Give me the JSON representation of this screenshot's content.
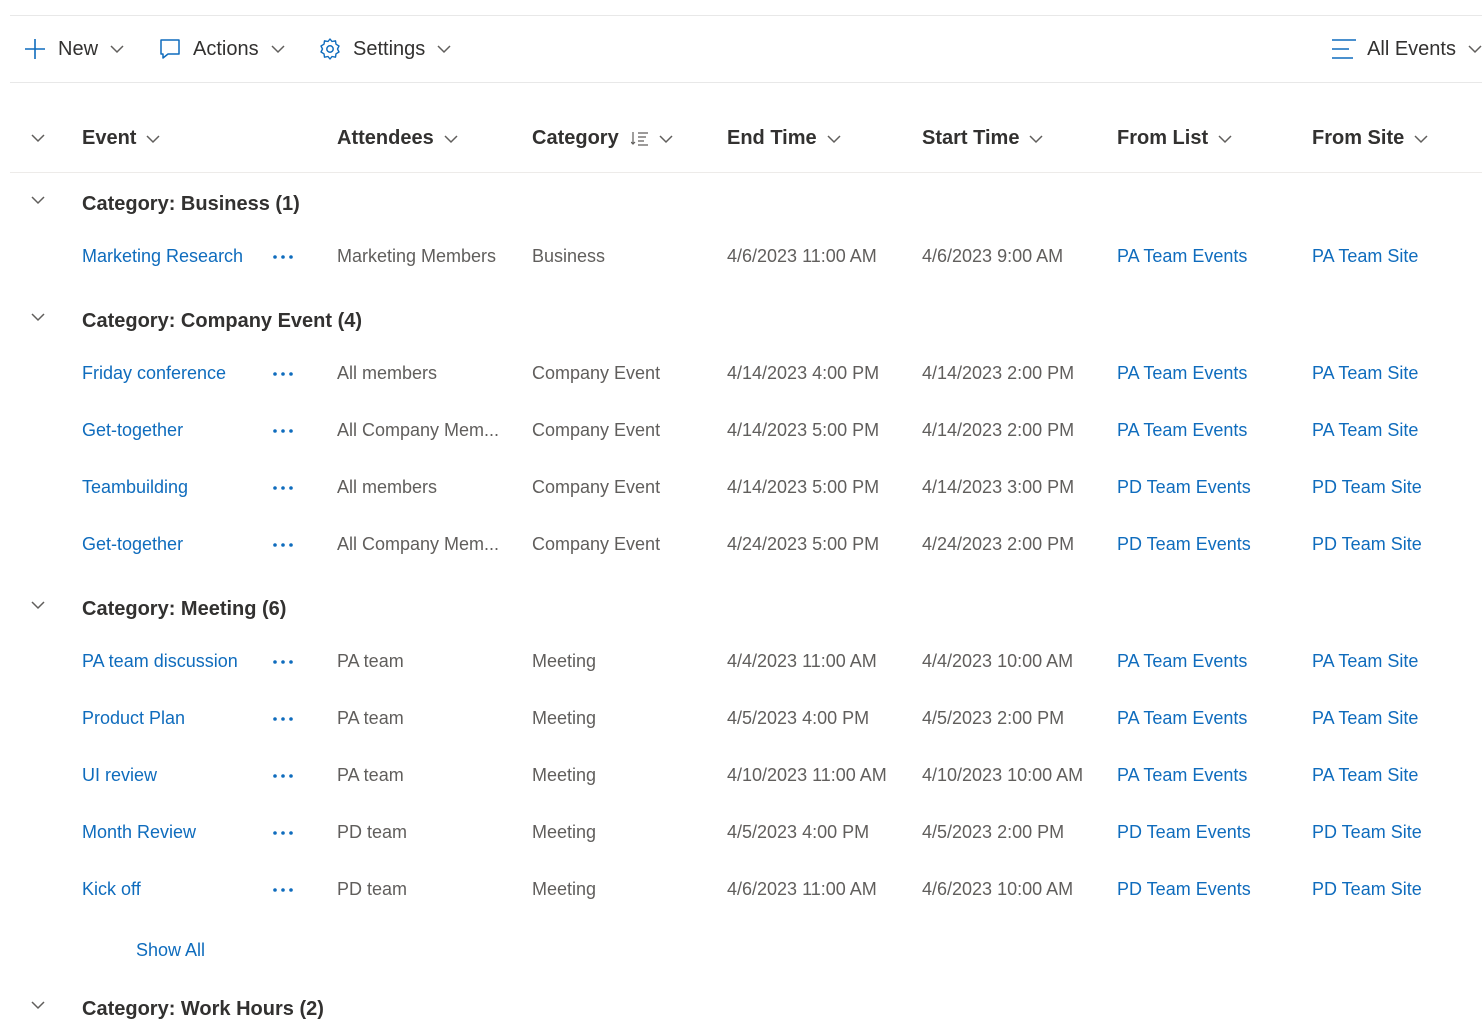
{
  "toolbar": {
    "new_label": "New",
    "actions_label": "Actions",
    "settings_label": "Settings",
    "view_label": "All Events"
  },
  "columns": {
    "event": "Event",
    "attendees": "Attendees",
    "category": "Category",
    "end_time": "End Time",
    "start_time": "Start Time",
    "from_list": "From List",
    "from_site": "From Site"
  },
  "groups": [
    {
      "title": "Category: Business (1)",
      "rows": [
        {
          "event": "Marketing Research",
          "attendees": "Marketing Members",
          "category": "Business",
          "end": "4/6/2023 11:00 AM",
          "start": "4/6/2023 9:00 AM",
          "list": "PA Team Events",
          "site": "PA Team Site"
        }
      ]
    },
    {
      "title": "Category: Company Event (4)",
      "rows": [
        {
          "event": "Friday conference",
          "attendees": "All members",
          "category": "Company Event",
          "end": "4/14/2023 4:00 PM",
          "start": "4/14/2023 2:00 PM",
          "list": "PA Team Events",
          "site": "PA Team Site"
        },
        {
          "event": "Get-together",
          "attendees": "All Company Mem...",
          "category": "Company Event",
          "end": "4/14/2023 5:00 PM",
          "start": "4/14/2023 2:00 PM",
          "list": "PA Team Events",
          "site": "PA Team Site"
        },
        {
          "event": "Teambuilding",
          "attendees": "All members",
          "category": "Company Event",
          "end": "4/14/2023 5:00 PM",
          "start": "4/14/2023 3:00 PM",
          "list": "PD Team Events",
          "site": "PD Team Site"
        },
        {
          "event": "Get-together",
          "attendees": "All Company Mem...",
          "category": "Company Event",
          "end": "4/24/2023 5:00 PM",
          "start": "4/24/2023 2:00 PM",
          "list": "PD Team Events",
          "site": "PD Team Site"
        }
      ]
    },
    {
      "title": "Category: Meeting (6)",
      "rows": [
        {
          "event": "PA team discussion",
          "attendees": "PA team",
          "category": "Meeting",
          "end": "4/4/2023 11:00 AM",
          "start": "4/4/2023 10:00 AM",
          "list": "PA Team Events",
          "site": "PA Team Site"
        },
        {
          "event": "Product Plan",
          "attendees": "PA team",
          "category": "Meeting",
          "end": "4/5/2023 4:00 PM",
          "start": "4/5/2023 2:00 PM",
          "list": "PA Team Events",
          "site": "PA Team Site"
        },
        {
          "event": "UI review",
          "attendees": "PA team",
          "category": "Meeting",
          "end": "4/10/2023 11:00 AM",
          "start": "4/10/2023 10:00 AM",
          "list": "PA Team Events",
          "site": "PA Team Site"
        },
        {
          "event": "Month Review",
          "attendees": "PD team",
          "category": "Meeting",
          "end": "4/5/2023 4:00 PM",
          "start": "4/5/2023 2:00 PM",
          "list": "PD Team Events",
          "site": "PD Team Site"
        },
        {
          "event": "Kick off",
          "attendees": "PD team",
          "category": "Meeting",
          "end": "4/6/2023 11:00 AM",
          "start": "4/6/2023 10:00 AM",
          "list": "PD Team Events",
          "site": "PD Team Site"
        }
      ],
      "show_all_label": "Show All"
    },
    {
      "title": "Category: Work Hours (2)",
      "rows": []
    }
  ],
  "colors": {
    "link": "#0f6cbd",
    "text": "#323130",
    "secondary_text": "#605e5c"
  }
}
